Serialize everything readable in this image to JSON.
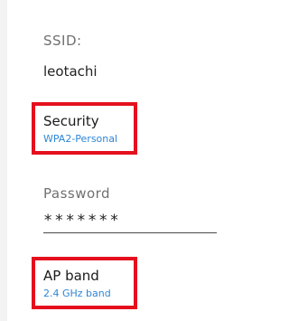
{
  "ssid": {
    "label": "SSID:",
    "value": "leotachi"
  },
  "security": {
    "title": "Security",
    "value": "WPA2-Personal"
  },
  "password": {
    "label": "Password",
    "value": "*******"
  },
  "ap_band": {
    "title": "AP band",
    "value": "2.4 GHz band"
  },
  "colors": {
    "highlight_border": "#e5101d",
    "link_blue": "#2f86d6"
  }
}
